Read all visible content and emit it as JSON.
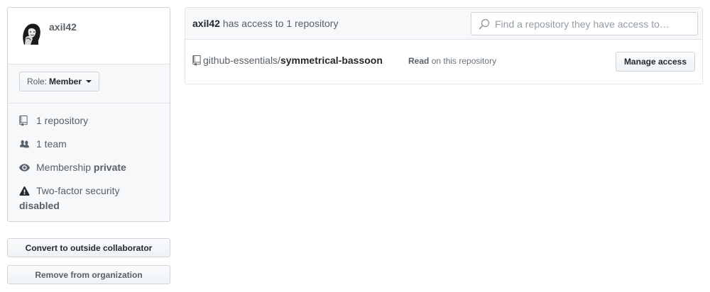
{
  "member": {
    "username": "axil42",
    "avatar_icon": "user-avatar"
  },
  "role": {
    "label": "Role:",
    "value": "Member"
  },
  "stats": {
    "repositories": "1 repository",
    "teams": "1 team",
    "membership_label": "Membership",
    "membership_value": "private",
    "twofactor_label": "Two-factor security",
    "twofactor_value": "disabled"
  },
  "actions": {
    "convert_label": "Convert to outside collaborator",
    "remove_label": "Remove from organization"
  },
  "access": {
    "username": "axil42",
    "summary": "has access to 1 repository",
    "search_placeholder": "Find a repository they have access to…"
  },
  "repositories": [
    {
      "owner": "github-essentials/",
      "name": "symmetrical-bassoon",
      "permission": "Read",
      "permission_suffix": "on this repository",
      "manage_label": "Manage access"
    }
  ],
  "colors": {
    "border": "#d1d5da",
    "muted_text": "#586069",
    "panel_bg": "#f6f8fa",
    "text": "#24292e"
  }
}
